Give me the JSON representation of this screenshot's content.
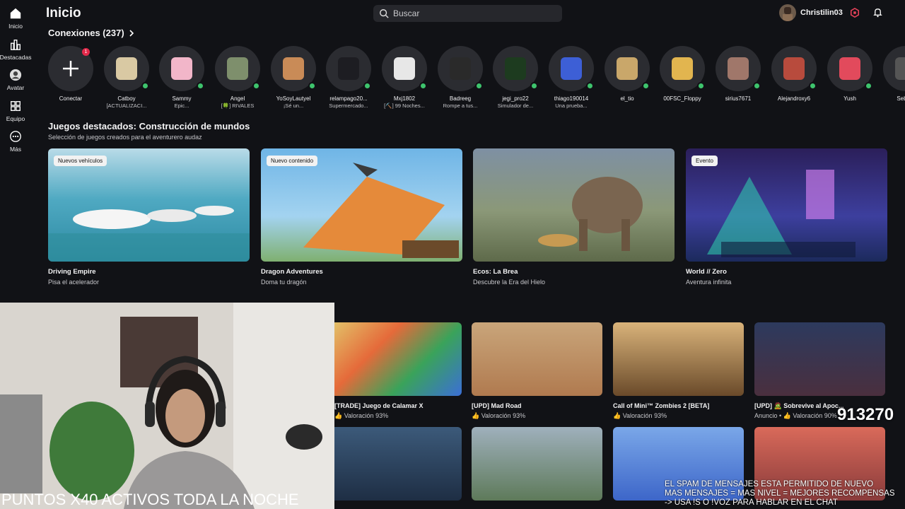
{
  "sidebar": {
    "items": [
      {
        "label": "Inicio",
        "icon": "home-icon"
      },
      {
        "label": "Destacadas",
        "icon": "chart-icon"
      },
      {
        "label": "Avatar",
        "icon": "avatar-icon"
      },
      {
        "label": "Equipo",
        "icon": "team-icon"
      },
      {
        "label": "Más",
        "icon": "more-icon"
      }
    ]
  },
  "header": {
    "title": "Inicio",
    "search_placeholder": "Buscar",
    "username": "Christilin03"
  },
  "connections": {
    "title": "Conexiones (237)",
    "connect_label": "Conectar",
    "connect_badge": "1",
    "friends": [
      {
        "name": "Catboy",
        "status": "[ACTUALIZACI...",
        "color": "#d9c9a3"
      },
      {
        "name": "Sammy",
        "status": "Epic...",
        "color": "#f2b6c9"
      },
      {
        "name": "Angel",
        "status": "[🍀] RIVALES",
        "color": "#7e8f6c"
      },
      {
        "name": "YoSoyLautyel",
        "status": "¡Sé un...",
        "color": "#c98b57"
      },
      {
        "name": "relampago20...",
        "status": "Supermercado...",
        "color": "#1d1d22"
      },
      {
        "name": "Mxj1802",
        "status": "[⛏️] 99 Noches...",
        "color": "#e7e7e7"
      },
      {
        "name": "Badreeg",
        "status": "Rompe a tus...",
        "color": "#2a2a2a"
      },
      {
        "name": "jegi_pro22",
        "status": "Simulador de...",
        "color": "#1d3b1f"
      },
      {
        "name": "thiago190014",
        "status": "Una prueba...",
        "color": "#3d5fd6"
      },
      {
        "name": "el_tio",
        "status": "",
        "color": "#c9a76a"
      },
      {
        "name": "00FSC_Floppy",
        "status": "",
        "color": "#e2b54f"
      },
      {
        "name": "sirius7671",
        "status": "",
        "color": "#a0776a"
      },
      {
        "name": "Alejandroxy6",
        "status": "",
        "color": "#b84b3d"
      },
      {
        "name": "Yush",
        "status": "",
        "color": "#e24a5c"
      },
      {
        "name": "Seba...",
        "status": "",
        "color": "#555"
      }
    ]
  },
  "featured": {
    "title": "Juegos destacados: Construcción de mundos",
    "subtitle": "Selección de juegos creados para el aventurero audaz",
    "cards": [
      {
        "tag": "Nuevos vehículos",
        "name": "Driving Empire",
        "desc": "Pisa el acelerador",
        "color": "#3f9fb3"
      },
      {
        "tag": "Nuevo contenido",
        "name": "Dragon Adventures",
        "desc": "Doma tu dragón",
        "color": "#5aa4d8"
      },
      {
        "tag": "",
        "name": "Ecos: La Brea",
        "desc": "Descubre la Era del Hielo",
        "color": "#7c8a70"
      },
      {
        "tag": "Evento",
        "name": "World // Zero",
        "desc": "Aventura infinita",
        "color": "#2a2f6a"
      }
    ]
  },
  "games_row1": [
    {
      "name": "[TRADE] Juego de Calamar X",
      "rating": "👍 Valoración 93%",
      "color": "#e07d3c"
    },
    {
      "name": "[UPD] Mad Road",
      "rating": "👍 Valoración 93%",
      "color": "#b98554"
    },
    {
      "name": "Call of Mini™ Zombies 2 [BETA]",
      "rating": "👍 Valoración 93%",
      "color": "#8a6b3d"
    },
    {
      "name": "[UPD] 🧟 Sobrevive al Apoc...",
      "rating": "Anuncio • 👍 Valoración 90%",
      "color": "#3b4a6e"
    }
  ],
  "games_row2_colors": [
    "#3c5a7a",
    "#8a9ba8",
    "#4d7ad6",
    "#c94b3b"
  ],
  "stream_overlay": {
    "bottom_text": "PUNTOS X40 ACTIVOS TODA LA NOCHE",
    "chat_rules": [
      "EL SPAM DE MENSAJES ESTA PERMITIDO DE NUEVO",
      "MAS MENSAJES = MAS NIVEL = MEJORES RECOMPENSAS",
      "-> USA !S  O !VOZ PARA HABLAR EN EL CHAT"
    ],
    "counter": "913270"
  }
}
